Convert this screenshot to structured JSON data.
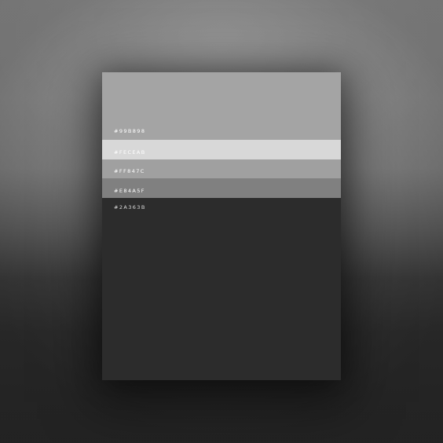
{
  "palette": {
    "swatches": [
      {
        "hex": "#99B898",
        "fill": "#a4a4a4",
        "label_color": "#ffffff"
      },
      {
        "hex": "#FECEAB",
        "fill": "#d8d8d8",
        "label_color": "#ffffff"
      },
      {
        "hex": "#FF847C",
        "fill": "#a0a0a0",
        "label_color": "#ffffff"
      },
      {
        "hex": "#E84A5F",
        "fill": "#808080",
        "label_color": "#ffffff"
      },
      {
        "hex": "#2A363B",
        "fill": "#2c2c2c",
        "label_color": "#dcdcdc"
      }
    ]
  }
}
